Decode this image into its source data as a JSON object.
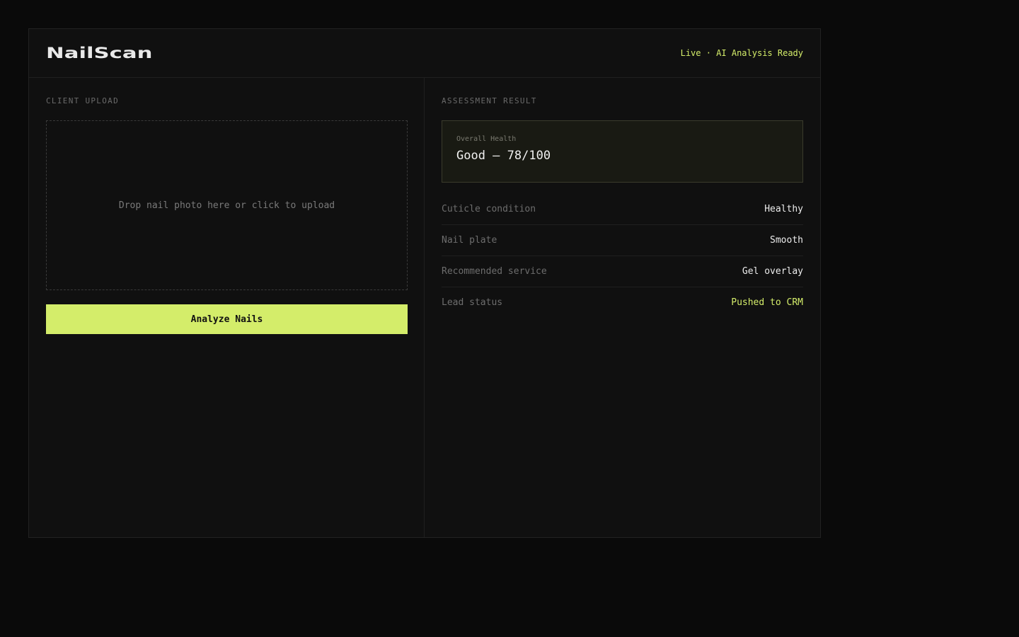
{
  "header": {
    "logo": "NailScan",
    "status": "Live · AI Analysis Ready"
  },
  "upload": {
    "section_label": "CLIENT UPLOAD",
    "dropzone_text": "Drop nail photo here or click to upload",
    "analyze_label": "Analyze Nails"
  },
  "result": {
    "section_label": "ASSESSMENT RESULT",
    "overall_label": "Overall Health",
    "overall_value": "Good — 78/100",
    "rows": [
      {
        "label": "Cuticle condition",
        "value": "Healthy"
      },
      {
        "label": "Nail plate",
        "value": "Smooth"
      },
      {
        "label": "Recommended service",
        "value": "Gel overlay"
      },
      {
        "label": "Lead status",
        "value": "Pushed to CRM"
      }
    ]
  },
  "colors": {
    "accent": "#d4ed6a",
    "background": "#0a0a0a",
    "panel": "#101010"
  }
}
